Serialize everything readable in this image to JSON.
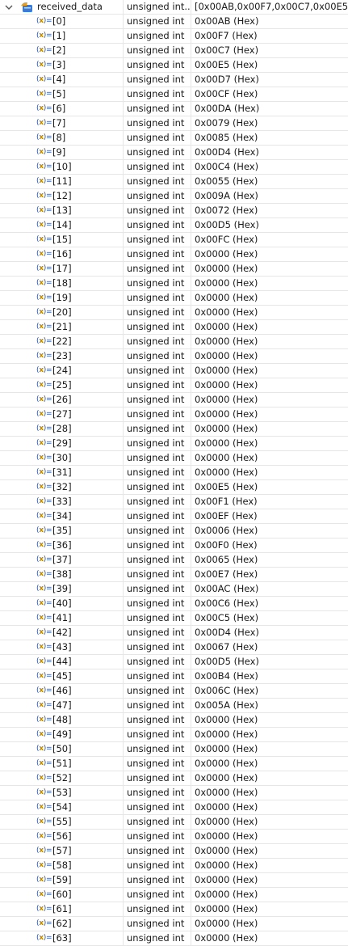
{
  "root": {
    "name": "received_data",
    "type": "unsigned int...",
    "value": "[0x00AB,0x00F7,0x00C7,0x00E5,0x00"
  },
  "icons": {
    "expand": "chevron-down-icon",
    "struct": "struct-variable-icon",
    "element": "variable-icon",
    "element_glyph_open": "(",
    "element_glyph_x": "x",
    "element_glyph_close": ")=",
    "element_color": "#3a5fa8",
    "struct_color_blue": "#3b7bd6",
    "struct_color_gold": "#e0a030"
  },
  "elements": [
    {
      "name": "[0]",
      "type": "unsigned int",
      "value": "0x00AB (Hex)"
    },
    {
      "name": "[1]",
      "type": "unsigned int",
      "value": "0x00F7 (Hex)"
    },
    {
      "name": "[2]",
      "type": "unsigned int",
      "value": "0x00C7 (Hex)"
    },
    {
      "name": "[3]",
      "type": "unsigned int",
      "value": "0x00E5 (Hex)"
    },
    {
      "name": "[4]",
      "type": "unsigned int",
      "value": "0x00D7 (Hex)"
    },
    {
      "name": "[5]",
      "type": "unsigned int",
      "value": "0x00CF (Hex)"
    },
    {
      "name": "[6]",
      "type": "unsigned int",
      "value": "0x00DA (Hex)"
    },
    {
      "name": "[7]",
      "type": "unsigned int",
      "value": "0x0079 (Hex)"
    },
    {
      "name": "[8]",
      "type": "unsigned int",
      "value": "0x0085 (Hex)"
    },
    {
      "name": "[9]",
      "type": "unsigned int",
      "value": "0x00D4 (Hex)"
    },
    {
      "name": "[10]",
      "type": "unsigned int",
      "value": "0x00C4 (Hex)"
    },
    {
      "name": "[11]",
      "type": "unsigned int",
      "value": "0x0055 (Hex)"
    },
    {
      "name": "[12]",
      "type": "unsigned int",
      "value": "0x009A (Hex)"
    },
    {
      "name": "[13]",
      "type": "unsigned int",
      "value": "0x0072 (Hex)"
    },
    {
      "name": "[14]",
      "type": "unsigned int",
      "value": "0x00D5 (Hex)"
    },
    {
      "name": "[15]",
      "type": "unsigned int",
      "value": "0x00FC (Hex)"
    },
    {
      "name": "[16]",
      "type": "unsigned int",
      "value": "0x0000 (Hex)"
    },
    {
      "name": "[17]",
      "type": "unsigned int",
      "value": "0x0000 (Hex)"
    },
    {
      "name": "[18]",
      "type": "unsigned int",
      "value": "0x0000 (Hex)"
    },
    {
      "name": "[19]",
      "type": "unsigned int",
      "value": "0x0000 (Hex)"
    },
    {
      "name": "[20]",
      "type": "unsigned int",
      "value": "0x0000 (Hex)"
    },
    {
      "name": "[21]",
      "type": "unsigned int",
      "value": "0x0000 (Hex)"
    },
    {
      "name": "[22]",
      "type": "unsigned int",
      "value": "0x0000 (Hex)"
    },
    {
      "name": "[23]",
      "type": "unsigned int",
      "value": "0x0000 (Hex)"
    },
    {
      "name": "[24]",
      "type": "unsigned int",
      "value": "0x0000 (Hex)"
    },
    {
      "name": "[25]",
      "type": "unsigned int",
      "value": "0x0000 (Hex)"
    },
    {
      "name": "[26]",
      "type": "unsigned int",
      "value": "0x0000 (Hex)"
    },
    {
      "name": "[27]",
      "type": "unsigned int",
      "value": "0x0000 (Hex)"
    },
    {
      "name": "[28]",
      "type": "unsigned int",
      "value": "0x0000 (Hex)"
    },
    {
      "name": "[29]",
      "type": "unsigned int",
      "value": "0x0000 (Hex)"
    },
    {
      "name": "[30]",
      "type": "unsigned int",
      "value": "0x0000 (Hex)"
    },
    {
      "name": "[31]",
      "type": "unsigned int",
      "value": "0x0000 (Hex)"
    },
    {
      "name": "[32]",
      "type": "unsigned int",
      "value": "0x00E5 (Hex)"
    },
    {
      "name": "[33]",
      "type": "unsigned int",
      "value": "0x00F1 (Hex)"
    },
    {
      "name": "[34]",
      "type": "unsigned int",
      "value": "0x00EF (Hex)"
    },
    {
      "name": "[35]",
      "type": "unsigned int",
      "value": "0x0006 (Hex)"
    },
    {
      "name": "[36]",
      "type": "unsigned int",
      "value": "0x00F0 (Hex)"
    },
    {
      "name": "[37]",
      "type": "unsigned int",
      "value": "0x0065 (Hex)"
    },
    {
      "name": "[38]",
      "type": "unsigned int",
      "value": "0x00E7 (Hex)"
    },
    {
      "name": "[39]",
      "type": "unsigned int",
      "value": "0x00AC (Hex)"
    },
    {
      "name": "[40]",
      "type": "unsigned int",
      "value": "0x00C6 (Hex)"
    },
    {
      "name": "[41]",
      "type": "unsigned int",
      "value": "0x00C5 (Hex)"
    },
    {
      "name": "[42]",
      "type": "unsigned int",
      "value": "0x00D4 (Hex)"
    },
    {
      "name": "[43]",
      "type": "unsigned int",
      "value": "0x0067 (Hex)"
    },
    {
      "name": "[44]",
      "type": "unsigned int",
      "value": "0x00D5 (Hex)"
    },
    {
      "name": "[45]",
      "type": "unsigned int",
      "value": "0x00B4 (Hex)"
    },
    {
      "name": "[46]",
      "type": "unsigned int",
      "value": "0x006C (Hex)"
    },
    {
      "name": "[47]",
      "type": "unsigned int",
      "value": "0x005A (Hex)"
    },
    {
      "name": "[48]",
      "type": "unsigned int",
      "value": "0x0000 (Hex)"
    },
    {
      "name": "[49]",
      "type": "unsigned int",
      "value": "0x0000 (Hex)"
    },
    {
      "name": "[50]",
      "type": "unsigned int",
      "value": "0x0000 (Hex)"
    },
    {
      "name": "[51]",
      "type": "unsigned int",
      "value": "0x0000 (Hex)"
    },
    {
      "name": "[52]",
      "type": "unsigned int",
      "value": "0x0000 (Hex)"
    },
    {
      "name": "[53]",
      "type": "unsigned int",
      "value": "0x0000 (Hex)"
    },
    {
      "name": "[54]",
      "type": "unsigned int",
      "value": "0x0000 (Hex)"
    },
    {
      "name": "[55]",
      "type": "unsigned int",
      "value": "0x0000 (Hex)"
    },
    {
      "name": "[56]",
      "type": "unsigned int",
      "value": "0x0000 (Hex)"
    },
    {
      "name": "[57]",
      "type": "unsigned int",
      "value": "0x0000 (Hex)"
    },
    {
      "name": "[58]",
      "type": "unsigned int",
      "value": "0x0000 (Hex)"
    },
    {
      "name": "[59]",
      "type": "unsigned int",
      "value": "0x0000 (Hex)"
    },
    {
      "name": "[60]",
      "type": "unsigned int",
      "value": "0x0000 (Hex)"
    },
    {
      "name": "[61]",
      "type": "unsigned int",
      "value": "0x0000 (Hex)"
    },
    {
      "name": "[62]",
      "type": "unsigned int",
      "value": "0x0000 (Hex)"
    },
    {
      "name": "[63]",
      "type": "unsigned int",
      "value": "0x0000 (Hex)"
    }
  ]
}
